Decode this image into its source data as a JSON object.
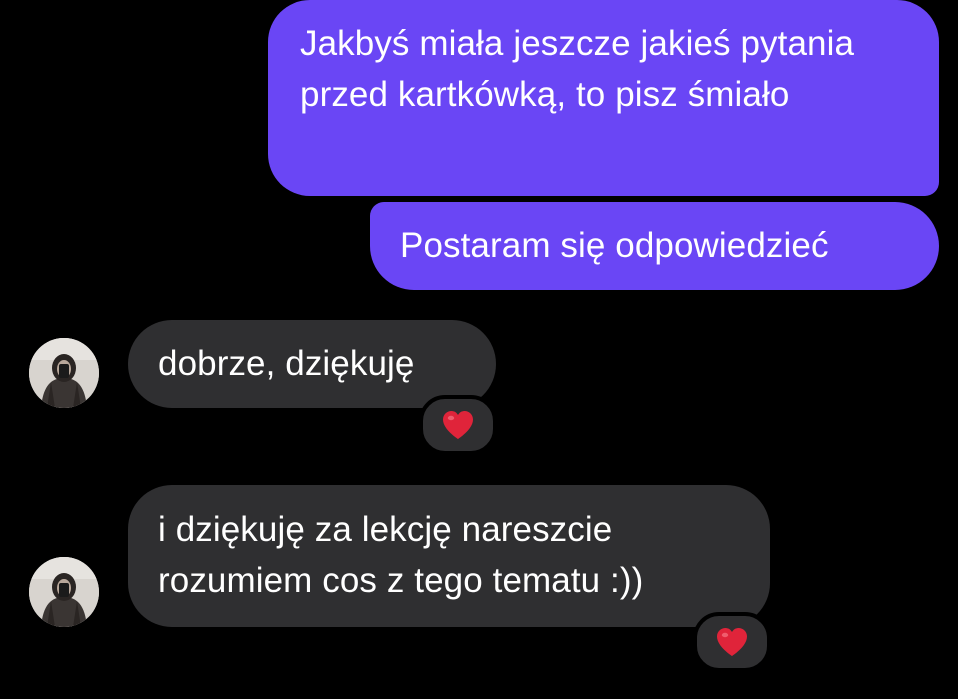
{
  "messages": [
    {
      "direction": "sent",
      "text": "Jakbyś miała jeszcze jakieś pytania przed kartkówką, to pisz śmiało"
    },
    {
      "direction": "sent",
      "text": "Postaram się odpowiedzieć"
    },
    {
      "direction": "received",
      "text": "dobrze, dziękuję",
      "reaction": "red-heart"
    },
    {
      "direction": "received",
      "text": "i dziękuję za lekcję nareszcie rozumiem cos z tego tematu :))",
      "reaction": "red-heart"
    }
  ],
  "colors": {
    "background": "#000000",
    "sent_bubble": "#6a46f5",
    "received_bubble": "#2f2f31",
    "text": "#ffffff",
    "heart": "#e0243a"
  }
}
